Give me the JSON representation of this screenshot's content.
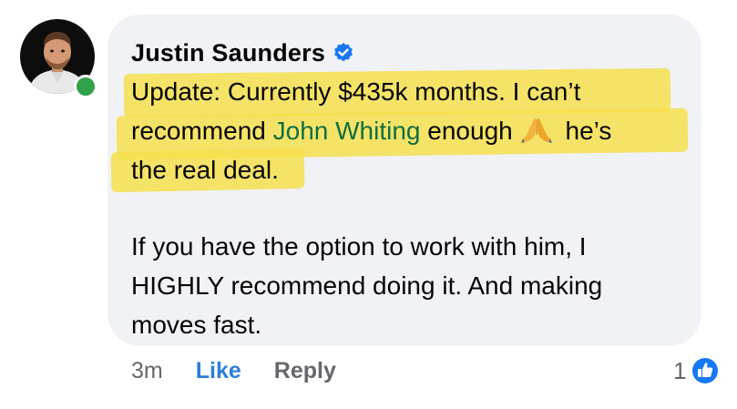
{
  "comment": {
    "author": "Justin Saunders",
    "verified": true,
    "online": true,
    "text": {
      "line1": "Update: Currently $435k months. I can’t",
      "line2_before": "recommend ",
      "mention": "John Whiting",
      "line2_after": " enough",
      "line2_end": " he’s",
      "line3": "the real deal.",
      "paragraph2_line1": "If you have the option to work with him, I",
      "paragraph2_line2": "HIGHLY recommend doing it. And making",
      "paragraph2_line3": "moves fast."
    },
    "emoji": "folded-hands-icon"
  },
  "actions": {
    "time": "3m",
    "like_label": "Like",
    "reply_label": "Reply"
  },
  "reactions": {
    "count": "1",
    "type": "like-reaction-icon"
  },
  "colors": {
    "bubble": "#f0f2f5",
    "highlight": "#f5e04d",
    "mention": "#0f6e40",
    "like_blue": "#2d7ed9",
    "muted": "#65676b",
    "online": "#31a24c"
  }
}
